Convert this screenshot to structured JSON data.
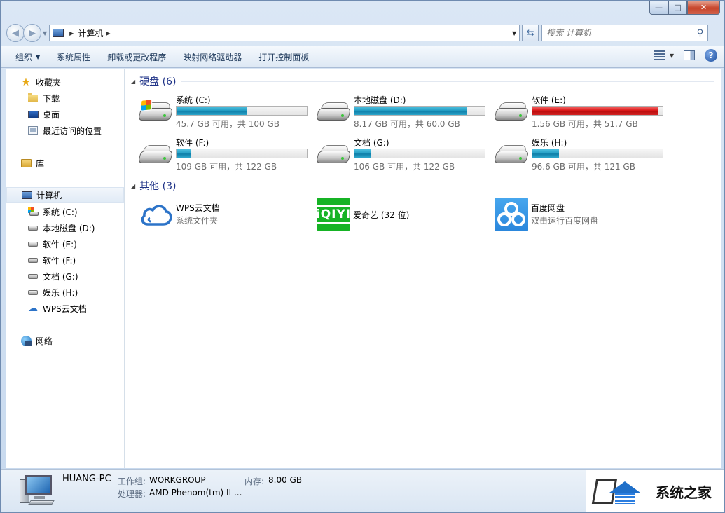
{
  "window": {
    "caption_buttons": {
      "minimize": "—",
      "maximize": "□",
      "close": "✕"
    }
  },
  "address_bar": {
    "breadcrumb": [
      "计算机"
    ],
    "search_placeholder": "搜索 计算机"
  },
  "command_bar": {
    "items": [
      "组织",
      "系统属性",
      "卸载或更改程序",
      "映射网络驱动器",
      "打开控制面板"
    ]
  },
  "nav_pane": {
    "favorites": {
      "label": "收藏夹",
      "items": [
        "下载",
        "桌面",
        "最近访问的位置"
      ]
    },
    "libraries": {
      "label": "库"
    },
    "computer": {
      "label": "计算机",
      "items": [
        "系统 (C:)",
        "本地磁盘 (D:)",
        "软件 (E:)",
        "软件 (F:)",
        "文档 (G:)",
        "娱乐 (H:)",
        "WPS云文档"
      ]
    },
    "network": {
      "label": "网络"
    }
  },
  "content": {
    "hard_disks": {
      "header": "硬盘 (6)",
      "drives": [
        {
          "name": "系统 (C:)",
          "info": "45.7 GB 可用，共 100 GB",
          "used_fraction": 0.543,
          "color": "#26a0c6"
        },
        {
          "name": "本地磁盘 (D:)",
          "info": "8.17 GB 可用，共 60.0 GB",
          "used_fraction": 0.864,
          "color": "#26a0c6"
        },
        {
          "name": "软件 (E:)",
          "info": "1.56 GB 可用，共 51.7 GB",
          "used_fraction": 0.97,
          "color": "#de1b1b"
        },
        {
          "name": "软件 (F:)",
          "info": "109 GB 可用，共 122 GB",
          "used_fraction": 0.107,
          "color": "#26a0c6"
        },
        {
          "name": "文档 (G:)",
          "info": "106 GB 可用，共 122 GB",
          "used_fraction": 0.131,
          "color": "#26a0c6"
        },
        {
          "name": "娱乐 (H:)",
          "info": "96.6 GB 可用，共 121 GB",
          "used_fraction": 0.202,
          "color": "#26a0c6"
        }
      ]
    },
    "other": {
      "header": "其他 (3)",
      "items": [
        {
          "name": "WPS云文档",
          "desc": "系统文件夹"
        },
        {
          "name": "爱奇艺 (32 位)",
          "desc": "",
          "icon_text": "iQIYI"
        },
        {
          "name": "百度网盘",
          "desc": "双击运行百度网盘"
        }
      ]
    }
  },
  "details": {
    "pc_name": "HUANG-PC",
    "workgroup_label": "工作组:",
    "workgroup_value": "WORKGROUP",
    "memory_label": "内存:",
    "memory_value": "8.00 GB",
    "cpu_label": "处理器:",
    "cpu_value": "AMD Phenom(tm) II ..."
  },
  "watermark": {
    "text": "系统之家"
  }
}
